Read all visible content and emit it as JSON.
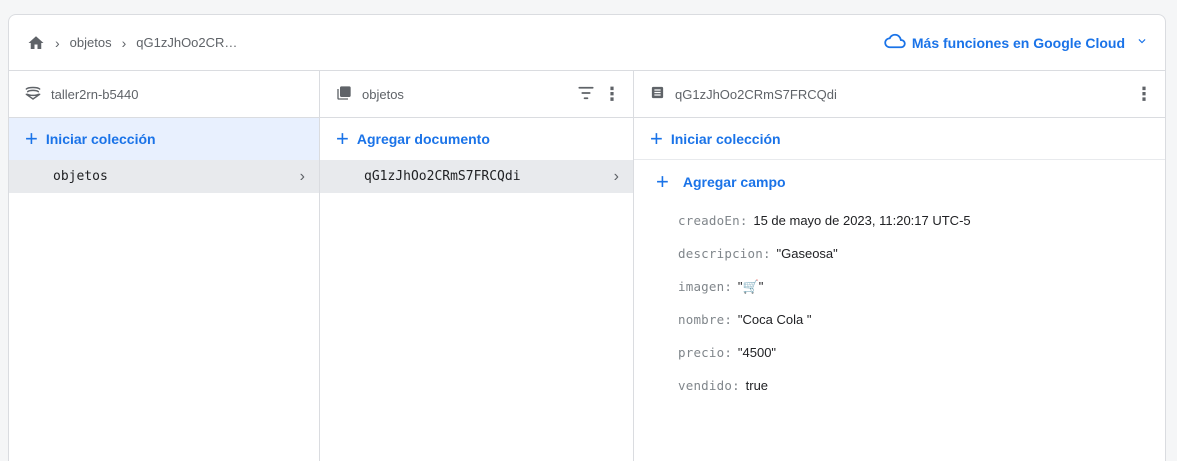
{
  "breadcrumb": {
    "items": [
      "objetos",
      "qG1zJhOo2CR…"
    ]
  },
  "header": {
    "cloud_link": "Más funciones en Google Cloud"
  },
  "colors": {
    "accent": "#1a73e8",
    "selected_bg": "#e8f0fe",
    "row_selected_bg": "#e8eaed"
  },
  "columns": {
    "root": {
      "title": "taller2rn-b5440",
      "icon": "database-icon",
      "action": "Iniciar colección",
      "items": [
        {
          "label": "objetos"
        }
      ]
    },
    "collection": {
      "title": "objetos",
      "icon": "collection-icon",
      "action": "Agregar documento",
      "items": [
        {
          "label": "qG1zJhOo2CRmS7FRCQdi"
        }
      ]
    },
    "document": {
      "title": "qG1zJhOo2CRmS7FRCQdi",
      "icon": "document-icon",
      "action_collection": "Iniciar colección",
      "action_field": "Agregar campo",
      "fields": [
        {
          "key": "creadoEn",
          "value": "15 de mayo de 2023, 11:20:17 UTC-5"
        },
        {
          "key": "descripcion",
          "value": "\"Gaseosa\""
        },
        {
          "key": "imagen",
          "value": "\"🛒\""
        },
        {
          "key": "nombre",
          "value": "\"Coca Cola \""
        },
        {
          "key": "precio",
          "value": "\"4500\""
        },
        {
          "key": "vendido",
          "value": "true"
        }
      ]
    }
  }
}
